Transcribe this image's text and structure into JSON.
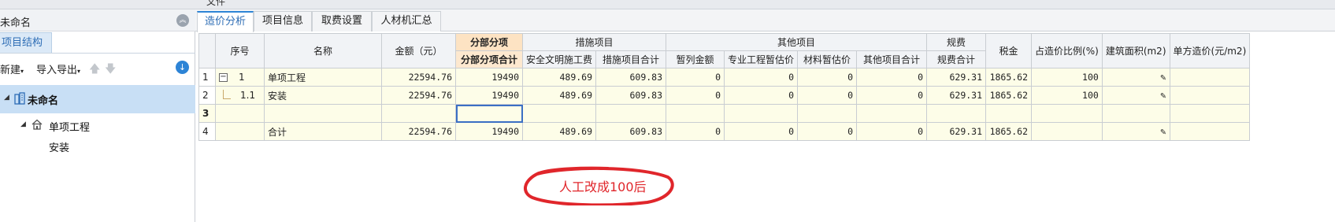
{
  "app": {
    "menu_label": "文件"
  },
  "left_panel": {
    "title": "未命名",
    "tab_label": "项目结构",
    "toolbar": {
      "new_label": "新建",
      "import_export_label": "导入导出"
    },
    "tree": {
      "root_label": "未命名",
      "child_label": "单项工程",
      "grandchild_label": "安装"
    }
  },
  "tabs": [
    {
      "label": "造价分析"
    },
    {
      "label": "项目信息"
    },
    {
      "label": "取费设置"
    },
    {
      "label": "人材机汇总"
    }
  ],
  "grid": {
    "headers": {
      "seq": "序号",
      "name": "名称",
      "amount": "金额（元）",
      "fbfx": "分部分项",
      "fbfx_total": "分部分项合计",
      "csxm": "措施项目",
      "aqwm": "安全文明施工费",
      "csxm_total": "措施项目合计",
      "qtxm": "其他项目",
      "zljje": "暂列金额",
      "zygczgj": "专业工程暂估价",
      "clzgj": "材料暂估价",
      "qtxm_total": "其他项目合计",
      "gf": "规费",
      "gf_total": "规费合计",
      "sj": "税金",
      "zzjbl": "占造价比例(%)",
      "jzmj": "建筑面积(m2)",
      "dfzj": "单方造价(元/m2)"
    },
    "rows": [
      {
        "rownum": "1",
        "seq": "1",
        "name": "单项工程",
        "amount": "22594.76",
        "fbfx_total": "19490",
        "aqwm": "489.69",
        "csxm_total": "609.83",
        "zljje": "0",
        "zygczgj": "0",
        "clzgj": "0",
        "qtxm_total": "0",
        "gf_total": "629.31",
        "sj": "1865.62",
        "zzjbl": "100"
      },
      {
        "rownum": "2",
        "seq": "1.1",
        "name": "安装",
        "amount": "22594.76",
        "fbfx_total": "19490",
        "aqwm": "489.69",
        "csxm_total": "609.83",
        "zljje": "0",
        "zygczgj": "0",
        "clzgj": "0",
        "qtxm_total": "0",
        "gf_total": "629.31",
        "sj": "1865.62",
        "zzjbl": "100"
      },
      {
        "rownum": "3",
        "seq": "",
        "name": "",
        "amount": "",
        "fbfx_total": "",
        "aqwm": "",
        "csxm_total": "",
        "zljje": "",
        "zygczgj": "",
        "clzgj": "",
        "qtxm_total": "",
        "gf_total": "",
        "sj": "",
        "zzjbl": ""
      },
      {
        "rownum": "4",
        "seq": "",
        "name": "合计",
        "amount": "22594.76",
        "fbfx_total": "19490",
        "aqwm": "489.69",
        "csxm_total": "609.83",
        "zljje": "0",
        "zygczgj": "0",
        "clzgj": "0",
        "qtxm_total": "0",
        "gf_total": "629.31",
        "sj": "1865.62",
        "zzjbl": ""
      }
    ]
  },
  "annotation": {
    "text": "人工改成100后",
    "color": "#e0262b"
  },
  "colors": {
    "accent": "#2d84d6",
    "row_bg": "#fdfde8",
    "header_highlight": "#fde3c3"
  }
}
